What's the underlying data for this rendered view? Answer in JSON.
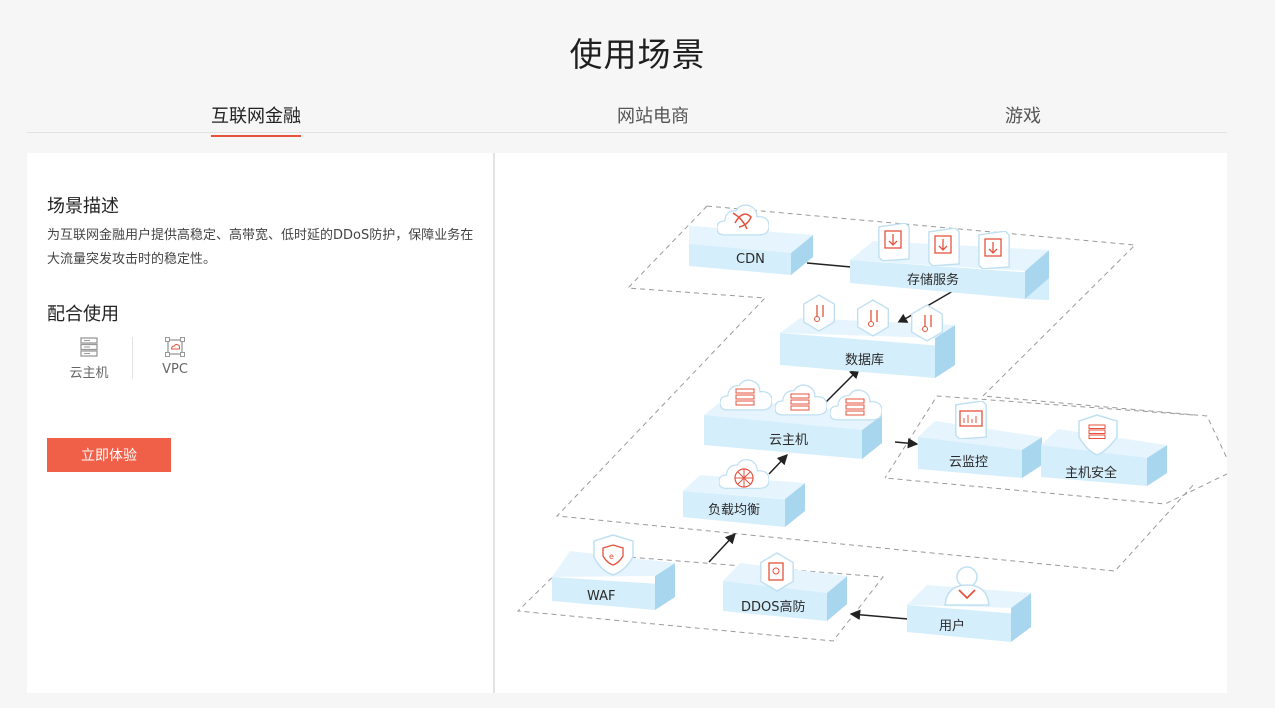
{
  "page": {
    "title": "使用场景"
  },
  "tabs": [
    {
      "label": "互联网金融",
      "active": true
    },
    {
      "label": "网站电商",
      "active": false
    },
    {
      "label": "游戏",
      "active": false
    }
  ],
  "scenario": {
    "description_title": "场景描述",
    "description": "为互联网金融用户提供高稳定、高带宽、低时延的DDoS防护，保障业务在大流量突发攻击时的稳定性。",
    "products_title": "配合使用",
    "products": [
      {
        "label": "云主机",
        "icon": "server-icon"
      },
      {
        "label": "VPC",
        "icon": "vpc-icon"
      }
    ],
    "cta_label": "立即体验"
  },
  "diagram": {
    "nodes": {
      "cdn": "CDN",
      "storage": "存储服务",
      "database": "数据库",
      "cloud_host": "云主机",
      "monitor": "云监控",
      "host_security": "主机安全",
      "load_balance": "负载均衡",
      "waf": "WAF",
      "ddos": "DDOS高防",
      "user": "用户"
    }
  },
  "colors": {
    "accent": "#f06049",
    "node_fill": "#d5eefb",
    "icon_stroke": "#e5533d"
  }
}
